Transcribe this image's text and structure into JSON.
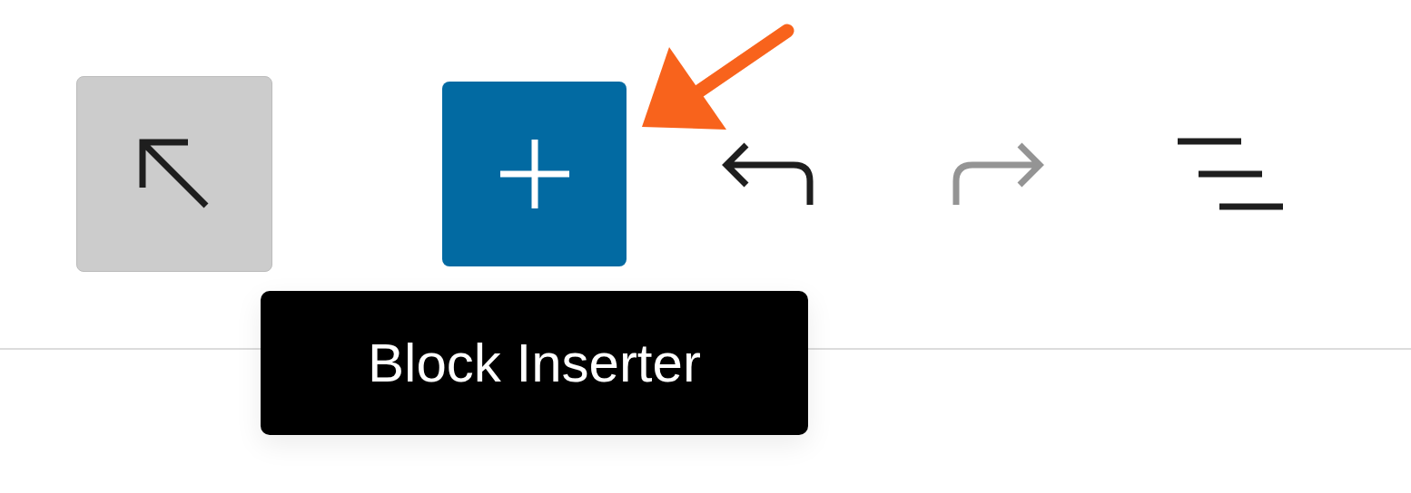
{
  "toolbar": {
    "buttons": [
      {
        "kind": "select",
        "pressed": true,
        "active": false,
        "disabled": false
      },
      {
        "kind": "inserter",
        "pressed": false,
        "active": true,
        "disabled": false
      },
      {
        "kind": "undo",
        "pressed": false,
        "active": false,
        "disabled": false
      },
      {
        "kind": "redo",
        "pressed": false,
        "active": false,
        "disabled": true
      },
      {
        "kind": "list-view",
        "pressed": false,
        "active": false,
        "disabled": false
      }
    ]
  },
  "tooltip": {
    "text": "Block Inserter"
  }
}
